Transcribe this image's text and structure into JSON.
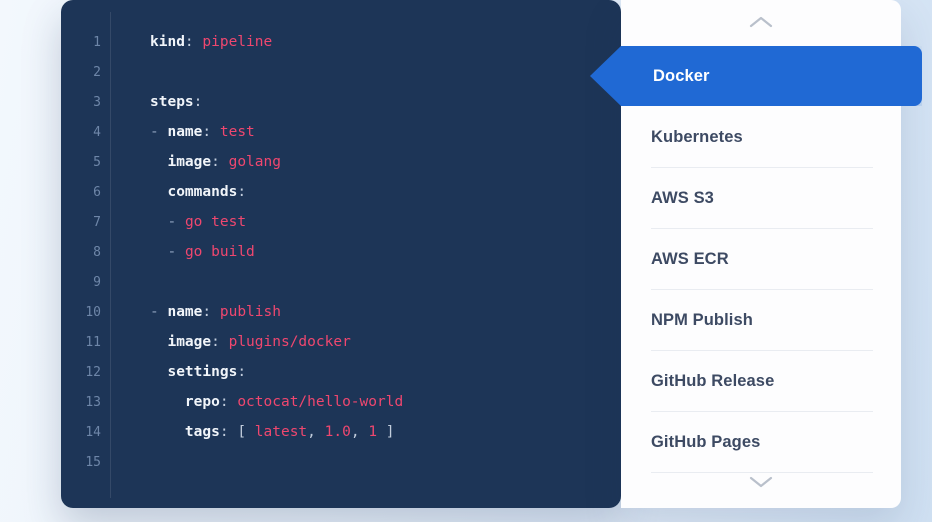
{
  "code_panel": {
    "language": "yaml",
    "lines": [
      {
        "num": "1",
        "tokens": [
          {
            "t": "key",
            "s": "kind"
          },
          {
            "t": "punct",
            "s": ": "
          },
          {
            "t": "val",
            "s": "pipeline"
          }
        ]
      },
      {
        "num": "2",
        "tokens": []
      },
      {
        "num": "3",
        "tokens": [
          {
            "t": "key",
            "s": "steps"
          },
          {
            "t": "punct",
            "s": ":"
          }
        ]
      },
      {
        "num": "4",
        "tokens": [
          {
            "t": "dash",
            "s": "- "
          },
          {
            "t": "key",
            "s": "name"
          },
          {
            "t": "punct",
            "s": ": "
          },
          {
            "t": "val",
            "s": "test"
          }
        ]
      },
      {
        "num": "5",
        "tokens": [
          {
            "t": "plain",
            "s": "  "
          },
          {
            "t": "key",
            "s": "image"
          },
          {
            "t": "punct",
            "s": ": "
          },
          {
            "t": "val",
            "s": "golang"
          }
        ]
      },
      {
        "num": "6",
        "tokens": [
          {
            "t": "plain",
            "s": "  "
          },
          {
            "t": "key",
            "s": "commands"
          },
          {
            "t": "punct",
            "s": ":"
          }
        ]
      },
      {
        "num": "7",
        "tokens": [
          {
            "t": "plain",
            "s": "  "
          },
          {
            "t": "dash",
            "s": "- "
          },
          {
            "t": "cmd",
            "s": "go test"
          }
        ]
      },
      {
        "num": "8",
        "tokens": [
          {
            "t": "plain",
            "s": "  "
          },
          {
            "t": "dash",
            "s": "- "
          },
          {
            "t": "cmd",
            "s": "go build"
          }
        ]
      },
      {
        "num": "9",
        "tokens": []
      },
      {
        "num": "10",
        "tokens": [
          {
            "t": "dash",
            "s": "- "
          },
          {
            "t": "key",
            "s": "name"
          },
          {
            "t": "punct",
            "s": ": "
          },
          {
            "t": "val",
            "s": "publish"
          }
        ]
      },
      {
        "num": "11",
        "tokens": [
          {
            "t": "plain",
            "s": "  "
          },
          {
            "t": "key",
            "s": "image"
          },
          {
            "t": "punct",
            "s": ": "
          },
          {
            "t": "val",
            "s": "plugins/docker"
          }
        ]
      },
      {
        "num": "12",
        "tokens": [
          {
            "t": "plain",
            "s": "  "
          },
          {
            "t": "key",
            "s": "settings"
          },
          {
            "t": "punct",
            "s": ":"
          }
        ]
      },
      {
        "num": "13",
        "tokens": [
          {
            "t": "plain",
            "s": "    "
          },
          {
            "t": "key",
            "s": "repo"
          },
          {
            "t": "punct",
            "s": ": "
          },
          {
            "t": "val",
            "s": "octocat/hello-world"
          }
        ]
      },
      {
        "num": "14",
        "tokens": [
          {
            "t": "plain",
            "s": "    "
          },
          {
            "t": "key",
            "s": "tags"
          },
          {
            "t": "punct",
            "s": ": "
          },
          {
            "t": "punct",
            "s": "[ "
          },
          {
            "t": "val",
            "s": "latest"
          },
          {
            "t": "punct",
            "s": ", "
          },
          {
            "t": "val",
            "s": "1.0"
          },
          {
            "t": "punct",
            "s": ", "
          },
          {
            "t": "val",
            "s": "1"
          },
          {
            "t": "punct",
            "s": " ]"
          }
        ]
      },
      {
        "num": "15",
        "tokens": []
      }
    ]
  },
  "list_panel": {
    "scroll_up_icon": "chevron-up-icon",
    "scroll_down_icon": "chevron-down-icon",
    "active_item": "Docker",
    "items": [
      {
        "label": "Docker",
        "active": true
      },
      {
        "label": "Kubernetes",
        "active": false
      },
      {
        "label": "AWS S3",
        "active": false
      },
      {
        "label": "AWS ECR",
        "active": false
      },
      {
        "label": "NPM Publish",
        "active": false
      },
      {
        "label": "GitHub Release",
        "active": false
      },
      {
        "label": "GitHub Pages",
        "active": false
      }
    ]
  },
  "colors": {
    "code_background": "#1d3557",
    "accent": "#2069d4",
    "value_text": "#ef476f",
    "panel_background": "#fdfdfe",
    "page_background": "#e8f0fa"
  }
}
